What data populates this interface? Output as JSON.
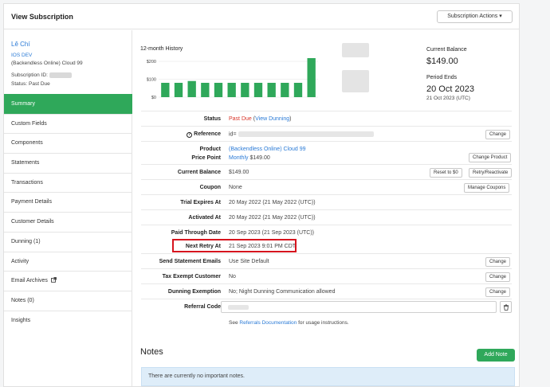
{
  "header": {
    "title": "View Subscription",
    "actions_label": "Subscription Actions ▾"
  },
  "customer": {
    "name": "Lê Chí",
    "org": "IOS DEV",
    "plan": "(Backendless Online) Cloud 99",
    "subscription_id_label": "Subscription ID:",
    "status_line": "Status: Past Due"
  },
  "nav": {
    "items": [
      {
        "label": "Summary",
        "active": true
      },
      {
        "label": "Custom Fields"
      },
      {
        "label": "Components"
      },
      {
        "label": "Statements"
      },
      {
        "label": "Transactions"
      },
      {
        "label": "Payment Details"
      },
      {
        "label": "Customer Details"
      },
      {
        "label": "Dunning (1)"
      },
      {
        "label": "Activity"
      },
      {
        "label": "Email Archives"
      },
      {
        "label": "Notes (0)"
      },
      {
        "label": "Insights"
      }
    ]
  },
  "history": {
    "title": "12-month History",
    "yticks": [
      "$200",
      "$100",
      "$0"
    ],
    "values": [
      80,
      80,
      90,
      80,
      80,
      80,
      80,
      80,
      80,
      80,
      80,
      350
    ],
    "ymax": 200,
    "bar_color": "#2fa85a"
  },
  "balance": {
    "current_label": "Current Balance",
    "current_value": "$149.00",
    "period_label": "Period Ends",
    "period_value": "20 Oct 2023",
    "period_utc": "21 Oct 2023 (UTC)"
  },
  "details": {
    "status": {
      "label": "Status",
      "value": "Past Due",
      "link": "View Dunning"
    },
    "reference": {
      "label": "Reference",
      "value": "id=",
      "button": "Change"
    },
    "product": {
      "label": "Product",
      "value": "(Backendless Online) Cloud 99"
    },
    "price_point": {
      "label": "Price Point",
      "link": "Monthly",
      "value": "$149.00",
      "button": "Change Product"
    },
    "current_balance": {
      "label": "Current Balance",
      "value": "$149.00",
      "button1": "Reset to $0",
      "button2": "Retry/Reactivate"
    },
    "coupon": {
      "label": "Coupon",
      "value": "None",
      "button": "Manage Coupons"
    },
    "trial_expires": {
      "label": "Trial Expires At",
      "value": "20 May 2022 (21 May 2022 (UTC))"
    },
    "activated": {
      "label": "Activated At",
      "value": "20 May 2022 (21 May 2022 (UTC))"
    },
    "paid_through": {
      "label": "Paid Through Date",
      "value": "20 Sep 2023 (21 Sep 2023 (UTC))"
    },
    "next_retry": {
      "label": "Next Retry At",
      "value": "21 Sep 2023 9:01 PM CDT"
    },
    "statement_emails": {
      "label": "Send Statement Emails",
      "value": "Use Site Default",
      "button": "Change"
    },
    "tax_exempt": {
      "label": "Tax Exempt Customer",
      "value": "No",
      "button": "Change"
    },
    "dunning_exemption": {
      "label": "Dunning Exemption",
      "value": "No; Night Dunning Communication allowed",
      "button": "Change"
    },
    "referral": {
      "label": "Referral Code",
      "hint_pre": "See",
      "hint_link": "Referrals Documentation",
      "hint_post": "for usage instructions."
    }
  },
  "notes": {
    "title": "Notes",
    "add_label": "Add Note",
    "empty_message": "There are currently no important notes."
  },
  "colors": {
    "accent": "#2fa85a",
    "link": "#2a7ad6",
    "danger": "#d9362b",
    "highlight": "#d6141e"
  }
}
